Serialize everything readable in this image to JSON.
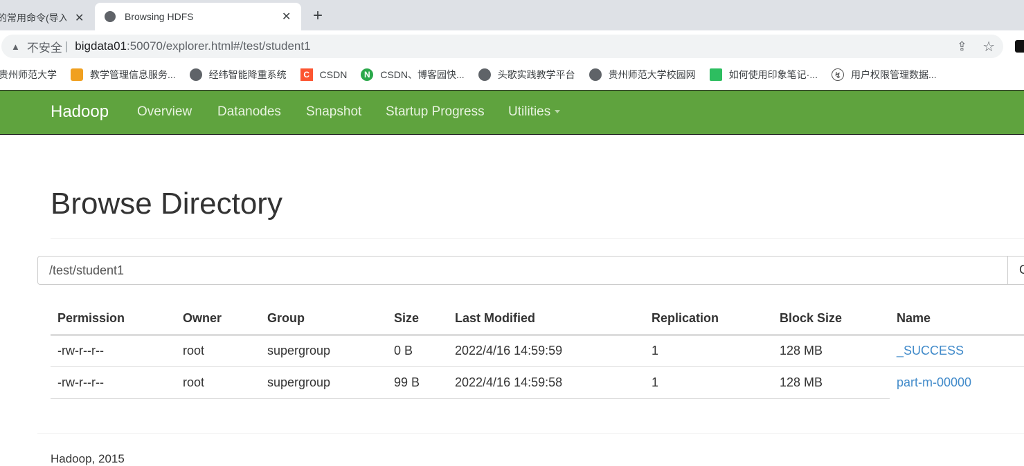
{
  "browser": {
    "tabs": [
      {
        "title": "的常用命令(导入",
        "active": false
      },
      {
        "title": "Browsing HDFS",
        "active": true
      }
    ],
    "address": {
      "security": "不安全",
      "host": "bigdata01",
      "path": ":50070/explorer.html#/test/student1"
    },
    "bookmarks": [
      {
        "label": "贵州师范大学",
        "icon": "none"
      },
      {
        "label": "教学管理信息服务...",
        "icon": "logo-icon",
        "color": "#f0a020"
      },
      {
        "label": "经纬智能降重系统",
        "icon": "globe-icon",
        "color": "#5f6368"
      },
      {
        "label": "CSDN",
        "icon": "csdn-icon",
        "color": "#fc5531"
      },
      {
        "label": "CSDN、博客园快...",
        "icon": "n-icon",
        "color": "#2aa84a"
      },
      {
        "label": "头歌实践教学平台",
        "icon": "globe-icon",
        "color": "#5f6368"
      },
      {
        "label": "贵州师范大学校园网",
        "icon": "globe-icon",
        "color": "#5f6368"
      },
      {
        "label": "如何使用印象笔记·...",
        "icon": "evernote-icon",
        "color": "#2dbe60"
      },
      {
        "label": "用户权限管理数据...",
        "icon": "logo-icon",
        "color": "#555555"
      }
    ]
  },
  "navbar": {
    "brand": "Hadoop",
    "items": [
      "Overview",
      "Datanodes",
      "Snapshot",
      "Startup Progress",
      "Utilities"
    ],
    "color": "#5fa33e"
  },
  "main": {
    "title": "Browse Directory",
    "path_value": "/test/student1",
    "go_label": "Go!",
    "table": {
      "headers": [
        "Permission",
        "Owner",
        "Group",
        "Size",
        "Last Modified",
        "Replication",
        "Block Size",
        "Name"
      ],
      "rows": [
        [
          "-rw-r--r--",
          "root",
          "supergroup",
          "0 B",
          "2022/4/16 14:59:59",
          "1",
          "128 MB",
          "_SUCCESS"
        ],
        [
          "-rw-r--r--",
          "root",
          "supergroup",
          "99 B",
          "2022/4/16 14:59:58",
          "1",
          "128 MB",
          "part-m-00000"
        ]
      ]
    }
  },
  "footer": "Hadoop, 2015"
}
